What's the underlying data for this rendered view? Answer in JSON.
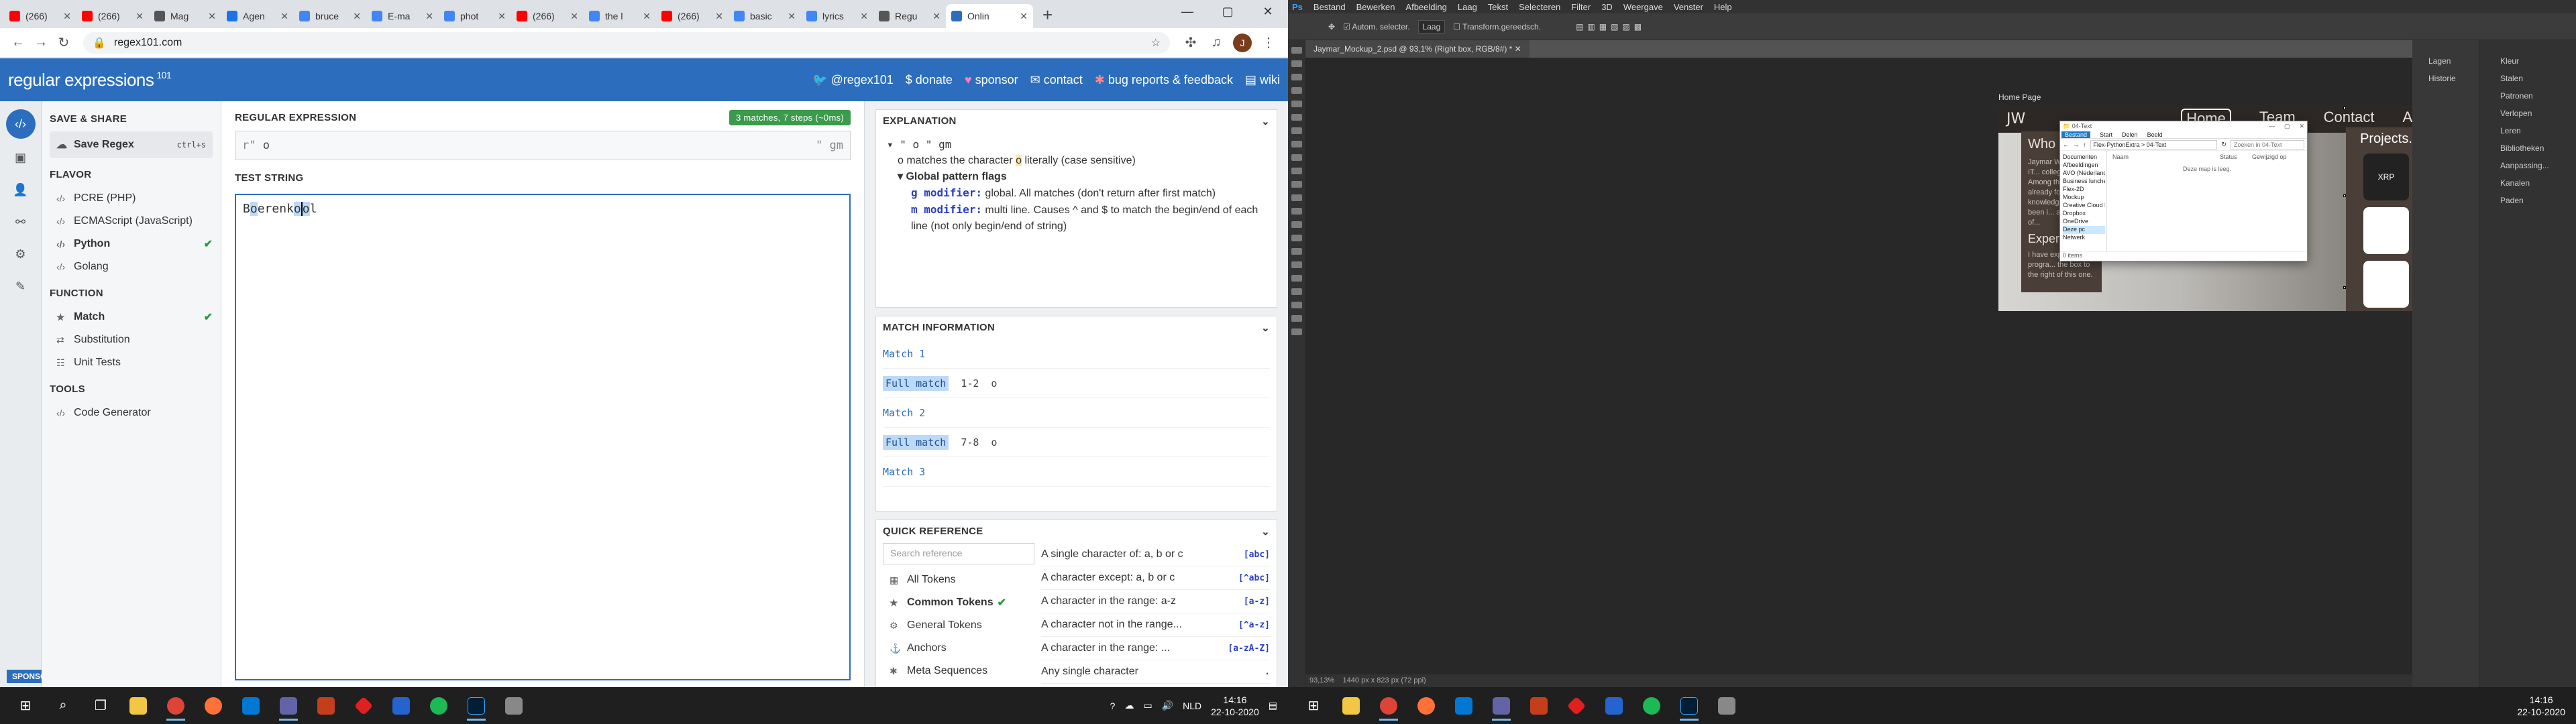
{
  "browser": {
    "tabs": [
      {
        "label": "(266)",
        "color": "#ff0000"
      },
      {
        "label": "(266)",
        "color": "#ff0000"
      },
      {
        "label": "Mag",
        "color": "#555555"
      },
      {
        "label": "Agen",
        "color": "#1a73e8"
      },
      {
        "label": "bruce",
        "color": "#4285f4"
      },
      {
        "label": "E-ma",
        "color": "#4285f4"
      },
      {
        "label": "phot",
        "color": "#4285f4"
      },
      {
        "label": "(266)",
        "color": "#ff0000"
      },
      {
        "label": "the l",
        "color": "#4285f4"
      },
      {
        "label": "(266)",
        "color": "#ff0000"
      },
      {
        "label": "basic",
        "color": "#4285f4"
      },
      {
        "label": "lyrics",
        "color": "#4285f4"
      },
      {
        "label": "Regu",
        "color": "#555555"
      },
      {
        "label": "Onlin",
        "color": "#2c6ebd"
      }
    ],
    "url": "regex101.com",
    "avatar_letter": "J"
  },
  "regex101": {
    "logo": "regular expressions",
    "logo_suffix": "101",
    "links": {
      "user": "@regex101",
      "donate": "donate",
      "sponsor": "sponsor",
      "contact": "contact",
      "bugs": "bug reports & feedback",
      "wiki": "wiki"
    },
    "sidebar": {
      "save_share_title": "SAVE & SHARE",
      "save_label": "Save Regex",
      "save_shortcut": "ctrl+s",
      "flavor_title": "FLAVOR",
      "flavors": [
        "PCRE (PHP)",
        "ECMAScript (JavaScript)",
        "Python",
        "Golang"
      ],
      "selected_flavor": "Python",
      "function_title": "FUNCTION",
      "functions": [
        "Match",
        "Substitution",
        "Unit Tests"
      ],
      "tools_title": "TOOLS",
      "tools": [
        "Code Generator"
      ],
      "sponsor_label": "SPONSOR"
    },
    "regex": {
      "title": "REGULAR EXPRESSION",
      "badge": "3 matches, 7 steps (~0ms)",
      "prefix": "r\"",
      "pattern": "o",
      "suffix": "\" gm"
    },
    "test": {
      "title": "TEST STRING",
      "pre": "B",
      "m1": "o",
      "mid1": "erenk",
      "m2": "o",
      "cur": "",
      "m3": "o",
      "post": "l"
    },
    "explanation": {
      "title": "EXPLANATION",
      "line1": "\" o \" gm",
      "line2a": "o matches the character ",
      "line2tok": "o",
      "line2b": " literally (case sensitive)",
      "flags_title": "Global pattern flags",
      "g_name": "g modifier:",
      "g_text": "global. All matches (don't return after first match)",
      "m_name": "m modifier:",
      "m_text": "multi line. Causes ^ and $ to match the begin/end of each line (not only begin/end of string)"
    },
    "match_info": {
      "title": "MATCH INFORMATION",
      "matches": [
        {
          "title": "Match 1",
          "label": "Full match",
          "range": "1-2",
          "value": "o"
        },
        {
          "title": "Match 2",
          "label": "Full match",
          "range": "7-8",
          "value": "o"
        }
      ],
      "match3_title": "Match 3"
    },
    "quick_ref": {
      "title": "QUICK REFERENCE",
      "search_placeholder": "Search reference",
      "categories": [
        "All Tokens",
        "Common Tokens",
        "General Tokens",
        "Anchors",
        "Meta Sequences"
      ],
      "selected": "Common Tokens",
      "items": [
        {
          "text": "A single character of: a, b or c",
          "code": "[abc]"
        },
        {
          "text": "A character except: a, b or c",
          "code": "[^abc]"
        },
        {
          "text": "A character in the range: a-z",
          "code": "[a-z]"
        },
        {
          "text": "A character not in the range...",
          "code": "[^a-z]"
        },
        {
          "text": "A character in the range: ...",
          "code": "[a-zA-Z]"
        },
        {
          "text": "Any single character",
          "code": "."
        }
      ]
    }
  },
  "taskbar_left": {
    "lang": "NLD",
    "time": "14:16",
    "date": "22-10-2020"
  },
  "photoshop": {
    "menu": [
      "Bestand",
      "Bewerken",
      "Afbeelding",
      "Laag",
      "Tekst",
      "Selecteren",
      "Filter",
      "3D",
      "Weergave",
      "Venster",
      "Help"
    ],
    "options": {
      "autoselect": "Autom. selecter.",
      "layer": "Laag",
      "transform": "Transform.gereedsch."
    },
    "doc_tab": "Jaymar_Mockup_2.psd @ 93,1% (Right box, RGB/8#) *",
    "status_zoom": "93,13%",
    "status_size": "1440 px x 823 px (72 ppi)",
    "panel_right": [
      "Kleur",
      "Stalen",
      "Patronen",
      "Verlopen",
      "Leren",
      "Bibliotheken",
      "Aanpassing...",
      "Kanalen",
      "Paden"
    ],
    "panel_left": [
      "Lagen",
      "Historie"
    ],
    "artboard": {
      "label": "Home Page",
      "logo": "JW",
      "nav": [
        "Home",
        "Team",
        "Contact",
        "About"
      ],
      "who_title": "Who am I?",
      "who_text": "Jaymar W... I am an IT... college in ... Among the ... I already fo... knowledge... now been i... amount of...",
      "exp_title": "Exper",
      "exp_text": "I have exp... the progra... the box to the right of this one.",
      "projects_title": "Projects.",
      "xrp": "XRP"
    },
    "explorer": {
      "title": "04-Text",
      "ribbon": [
        "Bestand",
        "Start",
        "Delen",
        "Beeld"
      ],
      "path": "Flex-PythonExtra  >  04-Text",
      "search_placeholder": "Zoeken in 04-Text",
      "nav": [
        "Documenten",
        "Afbeeldingen",
        "AVO (Nederland",
        "Business lunche",
        "Flex-2D",
        "Mockup",
        "Creative Cloud Fil",
        "Dropbox",
        "OneDrive",
        "Deze pc",
        "Netwerk"
      ],
      "nav_selected": "Deze pc",
      "cols": [
        "Naam",
        "Status",
        "Gewijzigd op"
      ],
      "empty": "Deze map is leeg.",
      "status": "0 items"
    }
  },
  "taskbar_right": {
    "time": "14:16",
    "date": "22-10-2020"
  },
  "colors": {
    "regex_blue": "#2c6ebd",
    "match_green": "#3b9a4b",
    "highlight": "#bcd9f7"
  }
}
